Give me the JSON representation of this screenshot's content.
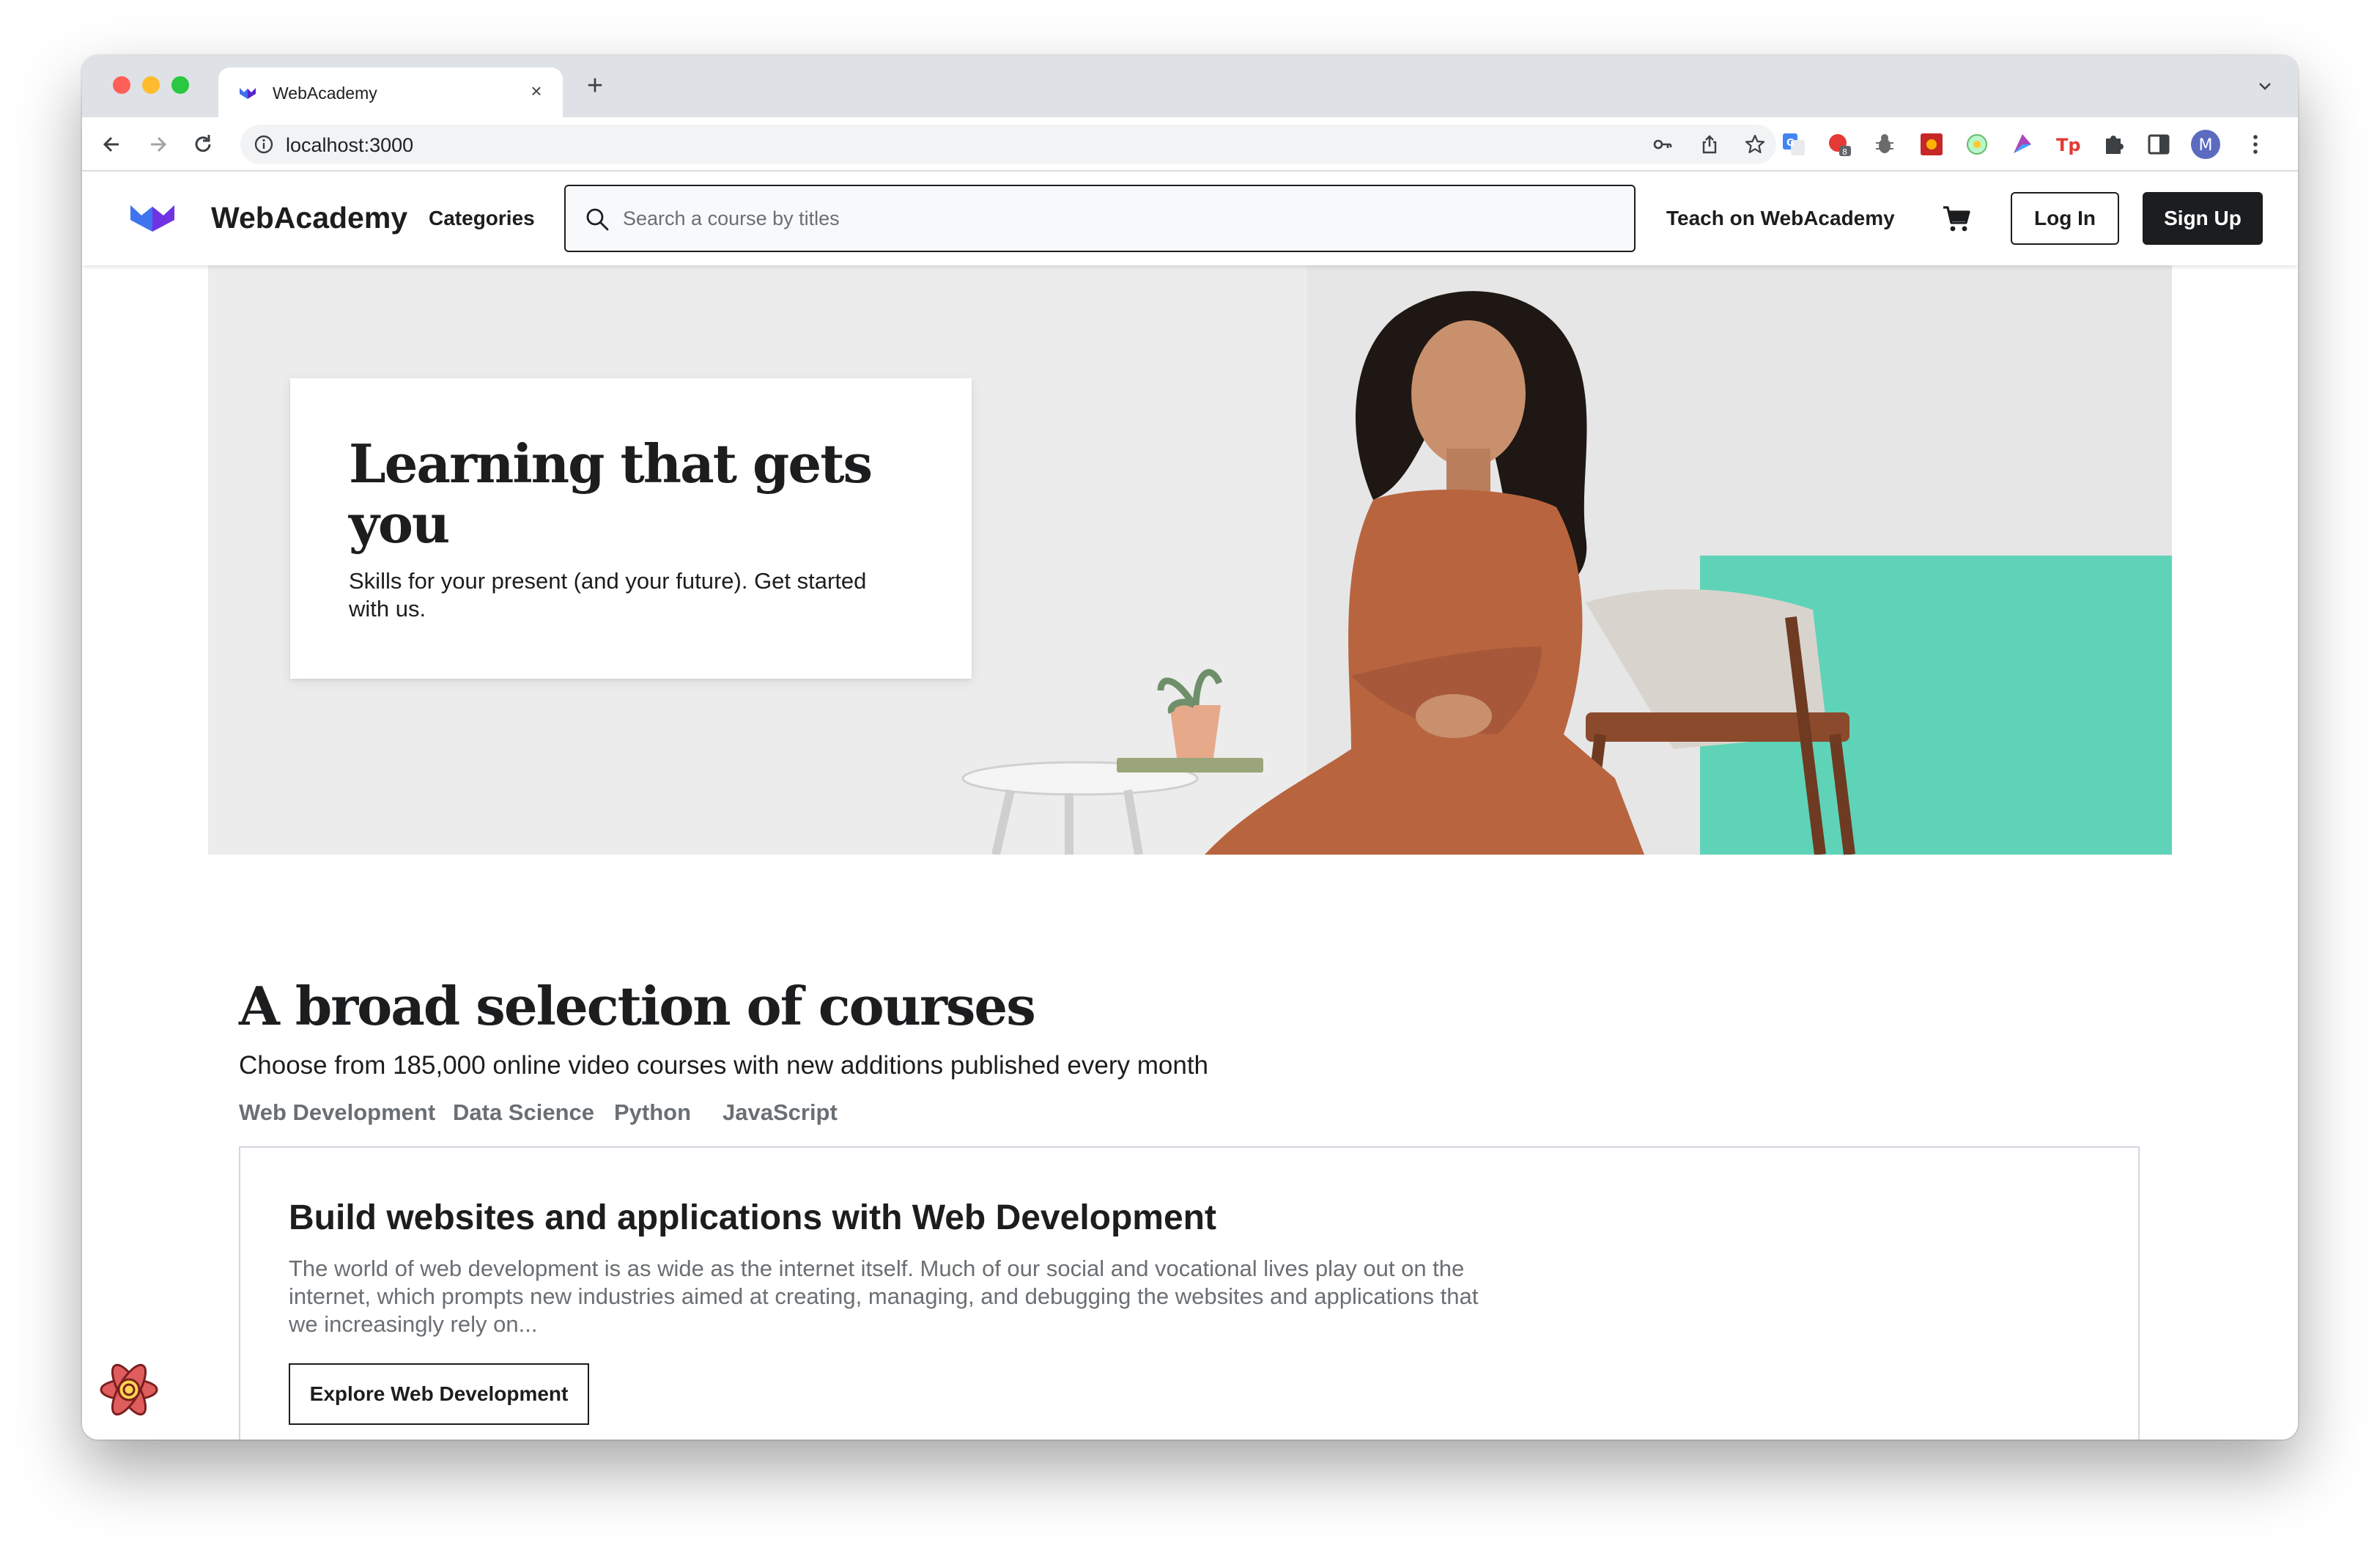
{
  "browser": {
    "tab_title": "WebAcademy",
    "tab_close_label": "×",
    "new_tab_label": "+",
    "url": "localhost:3000",
    "profile_initial": "M",
    "extension_badge_count": "8"
  },
  "header": {
    "brand": "WebAcademy",
    "categories_label": "Categories",
    "search_placeholder": "Search a course by titles",
    "teach_label": "Teach on WebAcademy",
    "login_label": "Log In",
    "signup_label": "Sign Up"
  },
  "hero": {
    "title": "Learning that gets you",
    "subtitle": "Skills for your present (and your future). Get started with us."
  },
  "courses": {
    "title": "A broad selection of courses",
    "subtitle": "Choose from 185,000 online video courses with new additions published every month",
    "tabs": [
      "Web Development",
      "Data Science",
      "Python",
      "JavaScript"
    ],
    "panel": {
      "title": "Build websites and applications with Web Development",
      "description": "The world of web development is as wide as the internet itself. Much of our social and vocational lives play out on the internet, which prompts new industries aimed at creating, managing, and debugging the websites and applications that we increasingly rely on...",
      "button_label": "Explore Web Development"
    }
  },
  "colors": {
    "accent_teal": "#5fd3b8",
    "dark": "#1c1d1f",
    "muted": "#6a6f73",
    "hero_bg": "#ececec",
    "logo_purple": "#5624d0",
    "logo_blue": "#3b82f6"
  }
}
